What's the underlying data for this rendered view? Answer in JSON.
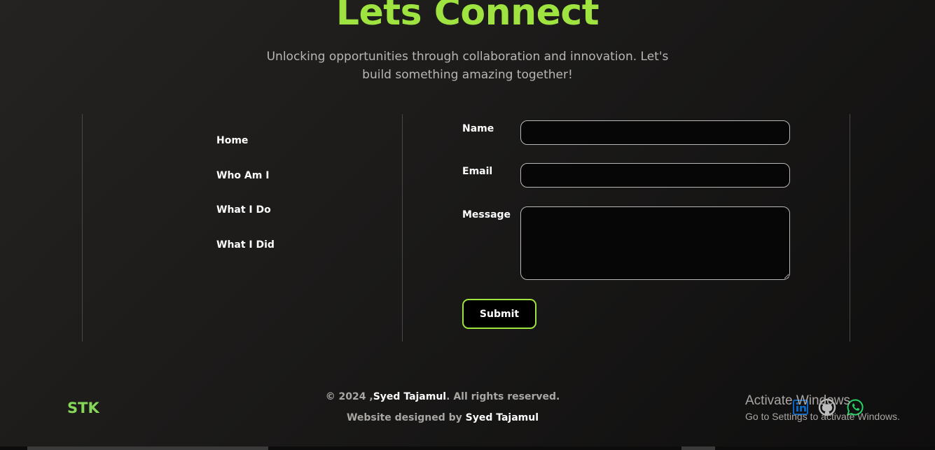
{
  "hero": {
    "title": "Lets Connect",
    "subtitle": "Unlocking opportunities through collaboration and innovation. Let's build something amazing together!"
  },
  "nav": {
    "items": [
      {
        "label": "Home"
      },
      {
        "label": "Who Am I"
      },
      {
        "label": "What I Do"
      },
      {
        "label": "What I Did"
      }
    ]
  },
  "form": {
    "name_label": "Name",
    "email_label": "Email",
    "message_label": "Message",
    "name_value": "",
    "email_value": "",
    "message_value": "",
    "submit_label": "Submit"
  },
  "footer": {
    "logo": "STK",
    "copyright_prefix": "© 2024 ,",
    "copyright_name": "Syed Tajamul",
    "copyright_suffix": ". All rights reserved.",
    "credit_prefix": "Website designed by ",
    "credit_name": "Syed Tajamul",
    "social_icons": [
      "linkedin-icon",
      "github-icon",
      "whatsapp-icon"
    ]
  },
  "os_overlay": {
    "line1": "Activate Windows",
    "line2": "Go to Settings to activate Windows."
  },
  "colors": {
    "accent": "#9ee340",
    "logo": "#86d65a",
    "background": "#1b1a19",
    "linkedin": "#0a66c2",
    "github": "#bcbcbc",
    "whatsapp": "#25d366"
  }
}
